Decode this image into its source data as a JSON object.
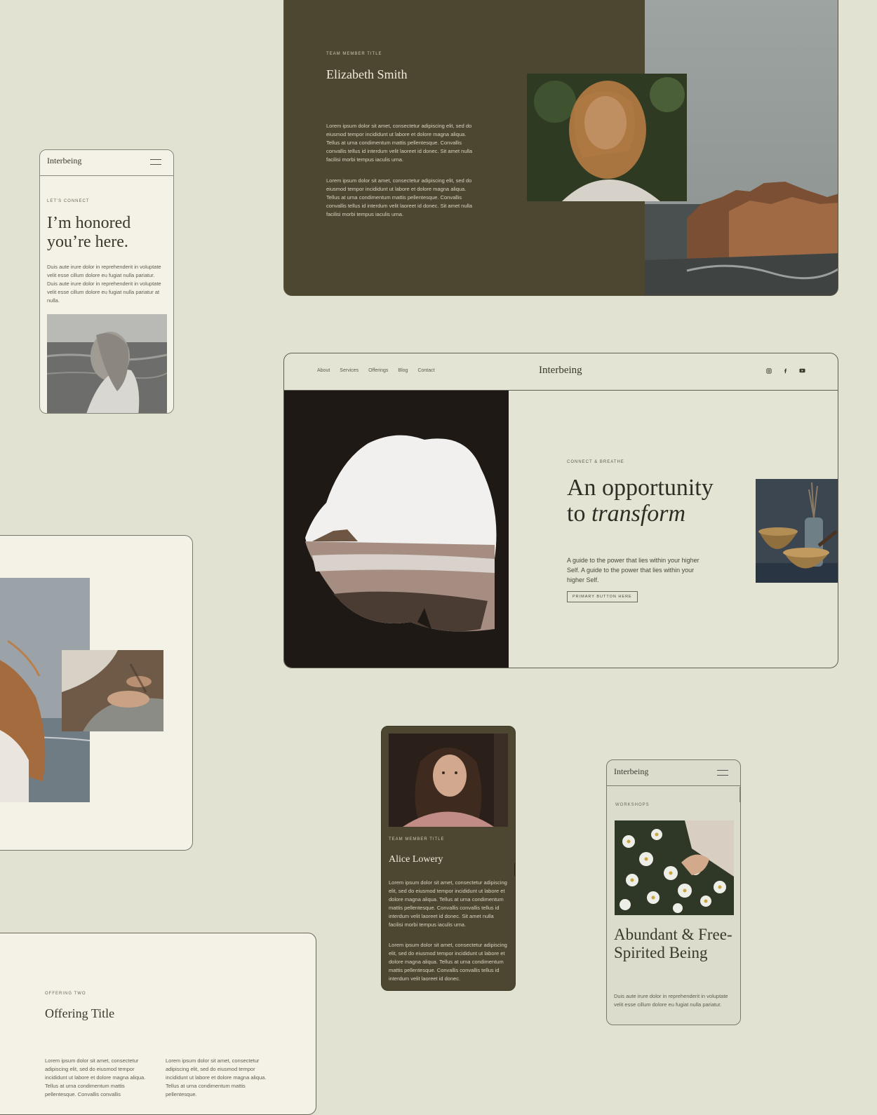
{
  "elizabeth_card": {
    "eyebrow": "TEAM MEMBER TITLE",
    "name": "Elizabeth Smith",
    "paragraph_1": "Lorem ipsum dolor sit amet, consectetur adipiscing elit, sed do eiusmod tempor incididunt ut labore et dolore magna aliqua. Tellus at urna condimentum mattis pellentesque. Convallis convallis tellus id interdum velit laoreet id donec. Sit amet nulla facilisi morbi tempus iaculis urna.",
    "paragraph_2": "Lorem ipsum dolor sit amet, consectetur adipiscing elit, sed do eiusmod tempor incididunt ut labore et dolore magna aliqua. Tellus at urna condimentum mattis pellentesque. Convallis convallis tellus id interdum velit laoreet id donec. Sit amet nulla facilisi morbi tempus iaculis urna."
  },
  "connect_card": {
    "logo": "Interbeing",
    "eyebrow": "LET'S CONNECT",
    "heading": "I’m honored you’re here.",
    "paragraph": "Duis aute irure dolor in reprehenderit in voluptate velit esse cillum dolore eu fugiat nulla pariatur. Duis aute irure dolor in reprehenderit in voluptate velit esse cillum dolore eu fugiat nulla pariatur at nulla."
  },
  "main_site": {
    "nav": [
      "About",
      "Services",
      "Offerings",
      "Blog",
      "Contact"
    ],
    "logo": "Interbeing",
    "social_icons": [
      "instagram-icon",
      "facebook-icon",
      "youtube-icon"
    ],
    "eyebrow": "CONNECT & BREATHE",
    "heading_line1": "An opportunity",
    "heading_line2_plain": "to ",
    "heading_line2_italic": "transform",
    "lead": "A guide to the power that lies within your higher Self. A guide to the power that lies within your higher Self.",
    "button_label": "PRIMARY BUTTON HERE"
  },
  "alice_card": {
    "eyebrow": "TEAM MEMBER TITLE",
    "name": "Alice Lowery",
    "paragraph_1": "Lorem ipsum dolor sit amet, consectetur adipiscing elit, sed do eiusmod tempor incididunt ut labore et dolore magna aliqua. Tellus at urna condimentum mattis pellentesque. Convallis convallis tellus id interdum velit laoreet id donec. Sit amet nulla facilisi morbi tempus iaculis urna.",
    "paragraph_2": "Lorem ipsum dolor sit amet, consectetur adipiscing elit, sed do eiusmod tempor incididunt ut labore et dolore magna aliqua. Tellus at urna condimentum mattis pellentesque. Convallis convallis tellus id interdum velit laoreet id donec."
  },
  "workshops_card": {
    "logo": "Interbeing",
    "eyebrow": "WORKSHOPS",
    "heading": "Abundant & Free-Spirited Being",
    "paragraph": "Duis aute irure dolor in reprehenderit in voluptate velit esse cillum dolore eu fugiat nulla pariatur."
  },
  "offering_card": {
    "eyebrow": "OFFERING TWO",
    "heading": "Offering Title",
    "paragraph_1": "Lorem ipsum dolor sit amet, consectetur adipiscing elit, sed do eiusmod tempor incididunt ut labore et dolore magna aliqua. Tellus at urna condimentum mattis pellentesque. Convallis convallis",
    "paragraph_2": "Lorem ipsum dolor sit amet, consectetur adipiscing elit, sed do eiusmod tempor incididunt ut labore et dolore magna aliqua. Tellus at urna condimentum mattis pellentesque."
  },
  "colors": {
    "background": "#e2e2d2",
    "olive": "#4d4731",
    "cream": "#f4f2e7",
    "ink": "#3a372b"
  }
}
